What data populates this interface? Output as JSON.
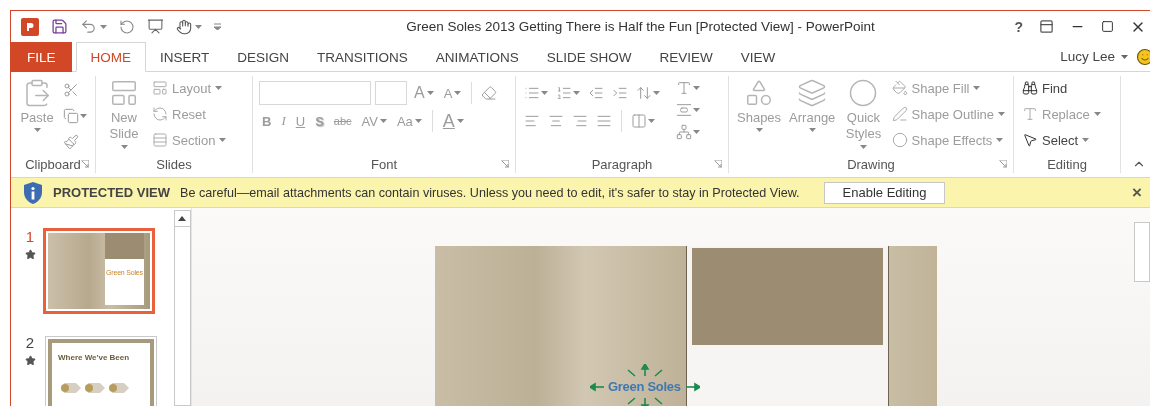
{
  "window": {
    "title": "Green Soles 2013 Getting There is Half the Fun [Protected View] - PowerPoint",
    "help": "?",
    "user": "Lucy Lee"
  },
  "tabs": [
    {
      "label": "FILE",
      "kind": "file",
      "selected": false
    },
    {
      "label": "HOME",
      "kind": "tab",
      "selected": true
    },
    {
      "label": "INSERT",
      "kind": "tab",
      "selected": false
    },
    {
      "label": "DESIGN",
      "kind": "tab",
      "selected": false
    },
    {
      "label": "TRANSITIONS",
      "kind": "tab",
      "selected": false
    },
    {
      "label": "ANIMATIONS",
      "kind": "tab",
      "selected": false
    },
    {
      "label": "SLIDE SHOW",
      "kind": "tab",
      "selected": false
    },
    {
      "label": "REVIEW",
      "kind": "tab",
      "selected": false
    },
    {
      "label": "VIEW",
      "kind": "tab",
      "selected": false
    }
  ],
  "ribbon": {
    "groups": [
      {
        "kind": "clipboard",
        "label": "Clipboard",
        "launcher": true,
        "large": [
          {
            "label": "Paste",
            "caret": true,
            "disabled": true
          }
        ]
      },
      {
        "kind": "slides",
        "label": "Slides",
        "launcher": false,
        "large": [
          {
            "label": "New Slide",
            "caret": true,
            "disabled": true
          }
        ],
        "commands": [
          {
            "label": "Layout",
            "caret": true,
            "disabled": true
          },
          {
            "label": "Reset",
            "caret": false,
            "disabled": true
          },
          {
            "label": "Section",
            "caret": true,
            "disabled": true
          }
        ]
      },
      {
        "kind": "font",
        "label": "Font",
        "launcher": true,
        "size_buttons": [
          "A",
          "A"
        ],
        "format_buttons": [
          {
            "glyph": "B",
            "caret": false,
            "disabled": true
          },
          {
            "glyph": "I",
            "caret": false,
            "disabled": true
          },
          {
            "glyph": "U",
            "caret": false,
            "disabled": true
          },
          {
            "glyph": "S",
            "caret": false,
            "disabled": true
          },
          {
            "glyph": "abc",
            "caret": false,
            "disabled": true
          },
          {
            "glyph": "AV",
            "caret": true,
            "disabled": true
          },
          {
            "glyph": "Aa",
            "caret": true,
            "disabled": true
          },
          {
            "glyph": "A",
            "caret": true,
            "disabled": true
          }
        ]
      },
      {
        "kind": "paragraph",
        "label": "Paragraph",
        "launcher": true
      },
      {
        "kind": "drawing",
        "label": "Drawing",
        "launcher": true,
        "large": [
          {
            "label": "Shapes",
            "caret": true,
            "disabled": true
          },
          {
            "label": "Arrange",
            "caret": true,
            "disabled": true
          },
          {
            "label": "Quick Styles",
            "caret": true,
            "disabled": true
          }
        ],
        "commands": [
          {
            "label": "Shape Fill",
            "caret": true,
            "disabled": true
          },
          {
            "label": "Shape Outline",
            "caret": true,
            "disabled": true
          },
          {
            "label": "Shape Effects",
            "caret": true,
            "disabled": true
          }
        ]
      },
      {
        "kind": "editing",
        "label": "Editing",
        "launcher": false,
        "commands": [
          {
            "label": "Find",
            "caret": false,
            "disabled": false
          },
          {
            "label": "Replace",
            "caret": true,
            "disabled": true
          },
          {
            "label": "Select",
            "caret": true,
            "disabled": false
          }
        ]
      }
    ]
  },
  "protected_bar": {
    "title": "PROTECTED VIEW",
    "message": "Be careful—email attachments can contain viruses. Unless you need to edit, it's safer to stay in Protected View.",
    "button": "Enable Editing",
    "close": "×"
  },
  "slides": [
    {
      "number": "1",
      "selected": true,
      "animated": true,
      "title": "Green Soles",
      "kind": "title"
    },
    {
      "number": "2",
      "selected": false,
      "animated": true,
      "title": "Where We've Been",
      "kind": "content"
    }
  ],
  "current_slide": {
    "logo": "Green Soles"
  }
}
